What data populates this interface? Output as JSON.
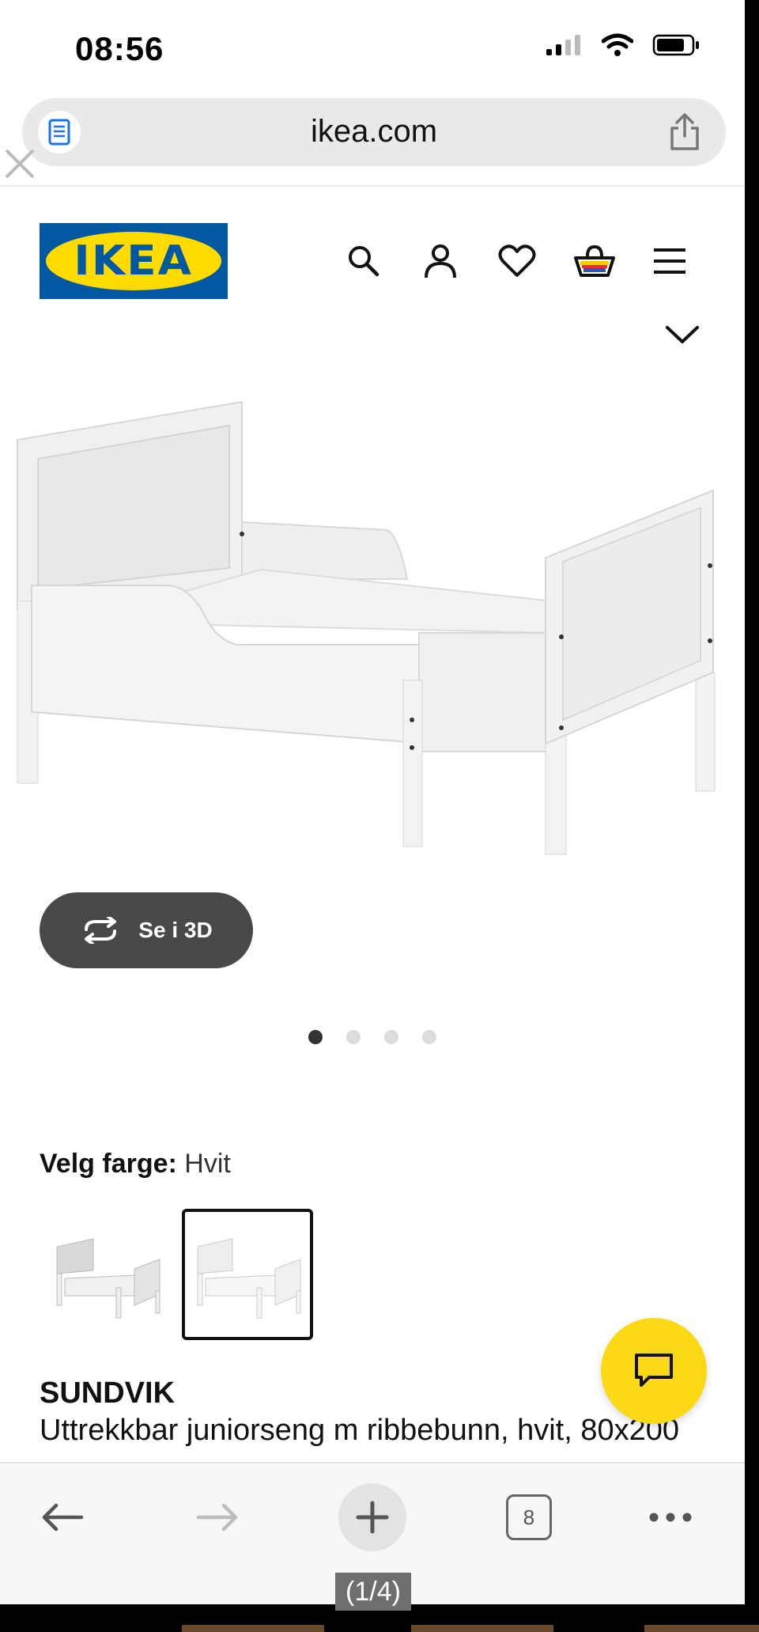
{
  "status_bar": {
    "time": "08:56"
  },
  "browser": {
    "url": "ikea.com",
    "tab_count": "8"
  },
  "brand": {
    "logo_text": "IKEA",
    "accent_blue": "#0058a3",
    "accent_yellow": "#ffdb00"
  },
  "header_icons": [
    "search-icon",
    "account-icon",
    "heart-icon",
    "basket-icon",
    "menu-icon"
  ],
  "gallery": {
    "view_3d_label": "Se i 3D",
    "total_images": 4,
    "active_index": 1
  },
  "color_select": {
    "label": "Velg farge:",
    "value": "Hvit",
    "selected_swatch": 2
  },
  "product": {
    "name": "SUNDVIK",
    "description": "Uttrekkbar juniorseng m ribbebunn, hvit, 80x200"
  },
  "viewer": {
    "page_counter": "(1/4)"
  }
}
